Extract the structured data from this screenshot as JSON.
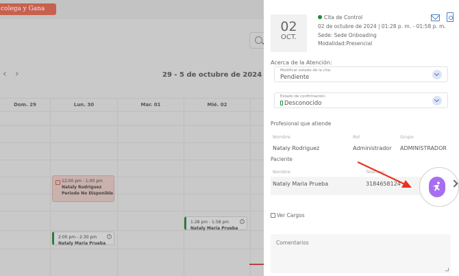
{
  "calendar": {
    "promo_text": "colega y Gana",
    "week_title": "29 - 5 de octubre de 2024",
    "prev_arrow": "‹",
    "next_arrow": "›",
    "days": [
      "Dom. 29",
      "Lun. 30",
      "Mar. 01",
      "Mié. 02"
    ],
    "events": [
      {
        "time": "12:00 pm - 1:00 pm",
        "title": "Nataly Rodriguez",
        "subtitle": "Periodo No Disponible"
      },
      {
        "time": "1:28 pm - 1:58 pm",
        "title": "Nataly Maria Prueba"
      },
      {
        "time": "2:00 pm - 2:30 pm",
        "title": "Nataly Maria Prueba"
      }
    ]
  },
  "panel": {
    "date_day": "02",
    "date_month": "OCT.",
    "appointment_type": "Cita de Control",
    "appointment_datetime": "02 de octubre de 2024 | 01:28 p. m. - 01:58 p. m.",
    "venue": "Sede: Sede Onboading",
    "modality": "Modalidad:Presencial",
    "about_label": "Acerca de la Atención:",
    "status_select": {
      "caption": "Modificar estado de la cita:",
      "value": "Pendiente"
    },
    "confirm_select": {
      "caption": "Estado de confirmación:",
      "value": "Desconocido"
    },
    "professional_label": "Profesional que atiende",
    "professional_headers": {
      "name": "Nombre",
      "role": "Rol",
      "group": "Grupo"
    },
    "professional": {
      "name": "Nataly Rodriguez",
      "role": "Administrador",
      "group": "ADMINISTRADOR"
    },
    "patient_label": "Paciente",
    "patient_headers": {
      "name": "Nombre",
      "phone": "Teléfono"
    },
    "patient": {
      "name": "Nataly Maria Prueba",
      "phone": "3184658124"
    },
    "charges_link": "Ver Cargos",
    "comments_label": "Comentarios"
  },
  "colors": {
    "accent_purple": "#a86ef0",
    "annotation_red": "#e8321e",
    "status_green": "#1f8a3a",
    "icon_blue": "#4a7fc4"
  },
  "icons": [
    "search-icon",
    "mail-icon",
    "document-icon",
    "chevron-down-icon",
    "phone-icon",
    "runner-icon",
    "chevron-right-icon",
    "edit-icon"
  ]
}
